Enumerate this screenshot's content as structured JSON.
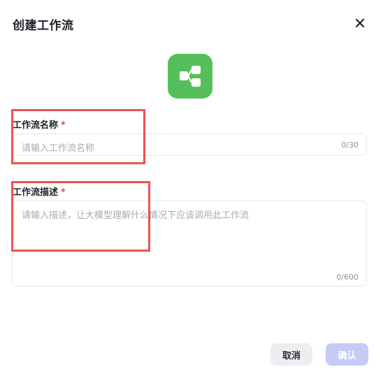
{
  "dialog": {
    "title": "创建工作流"
  },
  "icons": {
    "close": "close-icon",
    "app": "workflow-icon"
  },
  "colors": {
    "app_icon_bg": "#55c05b",
    "required_mark": "#e34d4d",
    "highlight_box": "#ef5350",
    "confirm_button_bg": "#c6cbf6",
    "cancel_button_bg": "#eceef2"
  },
  "form": {
    "name": {
      "label": "工作流名称",
      "required_mark": "*",
      "placeholder": "请输入工作流名称",
      "value": "",
      "counter": "0/30"
    },
    "description": {
      "label": "工作流描述",
      "required_mark": "*",
      "placeholder": "请输入描述，让大模型理解什么情况下应该调用此工作流",
      "value": "",
      "counter": "0/600"
    }
  },
  "footer": {
    "cancel_label": "取消",
    "confirm_label": "确认"
  }
}
